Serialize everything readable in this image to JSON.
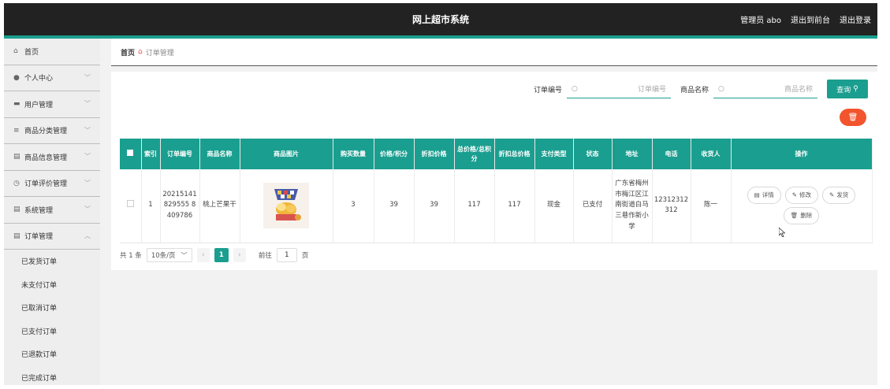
{
  "header": {
    "title": "网上超市系统",
    "user": "管理员 abo",
    "back_link": "退出到前台",
    "logout_link": "退出登录"
  },
  "sidebar": {
    "items": [
      {
        "label": "首页",
        "icon": "home-icon"
      },
      {
        "label": "个人中心",
        "icon": "user-icon"
      },
      {
        "label": "用户管理",
        "icon": "monitor-icon"
      },
      {
        "label": "商品分类管理",
        "icon": "list-icon"
      },
      {
        "label": "商品信息管理",
        "icon": "doc-icon"
      },
      {
        "label": "订单评价管理",
        "icon": "clock-icon"
      },
      {
        "label": "系统管理",
        "icon": "doc-icon"
      },
      {
        "label": "订单管理",
        "icon": "doc-icon"
      }
    ],
    "sub_items": [
      "已发货订单",
      "未支付订单",
      "已取消订单",
      "已支付订单",
      "已退款订单",
      "已完成订单"
    ]
  },
  "breadcrumb": {
    "home": "首页",
    "current": "订单管理"
  },
  "search": {
    "order_no_label": "订单编号",
    "order_no_placeholder": "订单编号",
    "product_name_label": "商品名称",
    "product_name_placeholder": "商品名称",
    "query_button": "查询"
  },
  "table": {
    "headers": [
      "索引",
      "订单编号",
      "商品名称",
      "商品图片",
      "购买数量",
      "价格/积分",
      "折扣价格",
      "总价格/总积分",
      "折扣总价格",
      "支付类型",
      "状态",
      "地址",
      "电话",
      "收货人",
      "操作"
    ],
    "rows": [
      {
        "index": "1",
        "order_no": "20215141829555 8409786",
        "product_name": "桃上芒果干",
        "quantity": "3",
        "price": "39",
        "discount_price": "39",
        "total": "117",
        "discount_total": "117",
        "pay_type": "现金",
        "status": "已支付",
        "address": "广东省梅州市梅江区江南街道白马三巷作新小学",
        "phone": "12312312312",
        "receiver": "陈一"
      }
    ],
    "actions": {
      "detail": "详情",
      "edit": "修改",
      "ship": "发货",
      "delete": "删除"
    }
  },
  "pagination": {
    "total": "共 1 条",
    "page_size": "10条/页",
    "current_page": "1",
    "goto_label": "前往",
    "goto_value": "1",
    "page_suffix": "页"
  },
  "colors": {
    "accent": "#1a9e8f",
    "danger": "#f2542d",
    "header_bg": "#222222"
  }
}
